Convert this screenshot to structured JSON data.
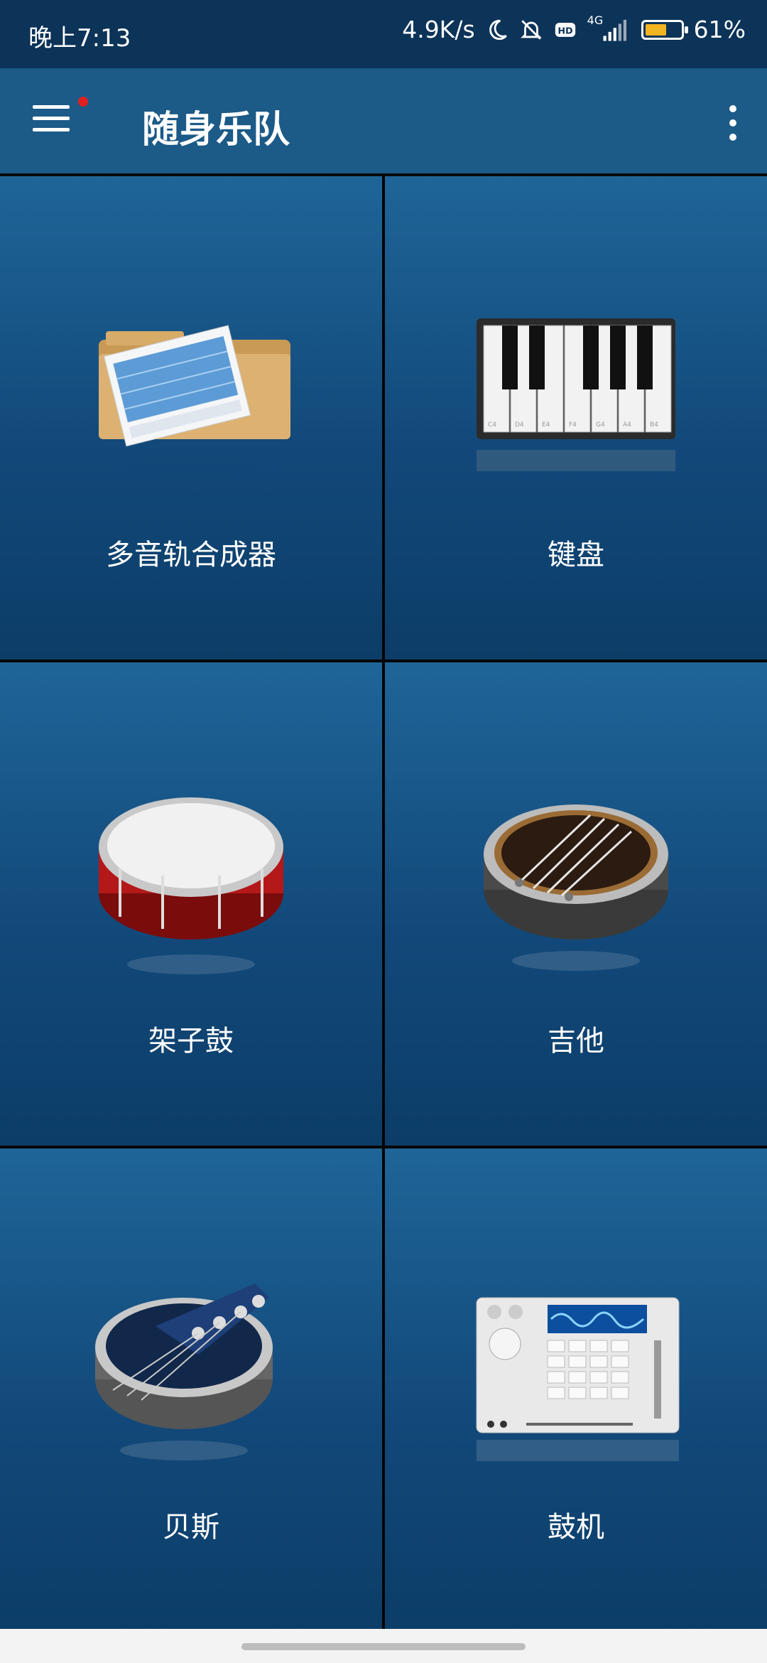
{
  "status_bar": {
    "time": "晚上7:13",
    "network_speed": "4.9K/s",
    "hd_badge": "HD",
    "signal_type": "4G",
    "battery_percent": "61%",
    "battery_level": 0.61,
    "icons": [
      "moon-icon",
      "mute-bell-icon",
      "hd-icon",
      "signal-icon",
      "battery-icon"
    ]
  },
  "app_bar": {
    "title": "随身乐队",
    "menu_icon": "hamburger-menu-icon",
    "notification_dot_color": "#e02020",
    "overflow_icon": "more-vert-icon"
  },
  "instruments": [
    {
      "label": "多音轨合成器",
      "icon": "multitrack-sequencer-icon"
    },
    {
      "label": "键盘",
      "icon": "piano-keyboard-icon",
      "key_labels": [
        "C4",
        "D4",
        "E4",
        "F4",
        "G4",
        "A4",
        "B4"
      ]
    },
    {
      "label": "架子鼓",
      "icon": "drum-kit-icon"
    },
    {
      "label": "吉他",
      "icon": "guitar-icon"
    },
    {
      "label": "贝斯",
      "icon": "bass-icon"
    },
    {
      "label": "鼓机",
      "icon": "drum-machine-icon"
    }
  ],
  "colors": {
    "app_bar": "#1c5a88",
    "status_bar": "#0c3358",
    "tile_top": "#1f6598",
    "tile_bottom": "#0c3d68",
    "battery_fill": "#f2b420"
  }
}
